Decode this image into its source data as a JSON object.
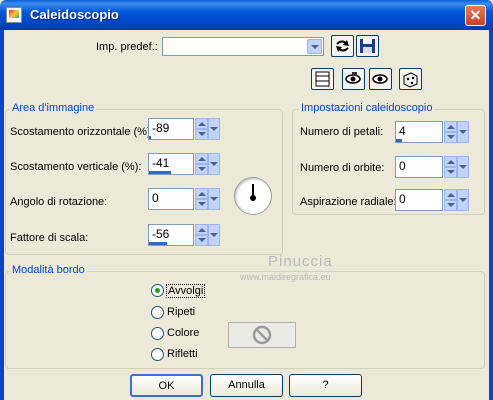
{
  "window": {
    "title": "Caleidoscopio",
    "close_glyph": "✕"
  },
  "preset": {
    "label": "Imp. predef.:",
    "value": ""
  },
  "toolbar": {
    "icons": [
      "reset-icon",
      "save-icon",
      "preview-window-icon",
      "eye-icon",
      "eye-icon",
      "randomize-icon"
    ]
  },
  "image_area": {
    "title": "Area d'immagine",
    "fields": [
      {
        "label": "Scostamento orizzontale (%):",
        "value": "-89"
      },
      {
        "label": "Scostamento verticale (%):",
        "value": "-41"
      },
      {
        "label": "Angolo di rotazione:",
        "value": "0"
      },
      {
        "label": "Fattore di scala:",
        "value": "-56"
      }
    ]
  },
  "kaleido": {
    "title": "Impostazioni caleidoscopio",
    "fields": [
      {
        "label": "Numero di petali:",
        "value": "4"
      },
      {
        "label": "Numero di orbite:",
        "value": "0"
      },
      {
        "label": "Aspirazione radiale:",
        "value": "0"
      }
    ]
  },
  "border_mode": {
    "title": "Modalità bordo",
    "options": [
      {
        "label": "Avvolgi",
        "selected": true
      },
      {
        "label": "Ripeti",
        "selected": false
      },
      {
        "label": "Colore",
        "selected": false
      },
      {
        "label": "Rifletti",
        "selected": false
      }
    ],
    "color_icon": "no-color-icon"
  },
  "watermark": {
    "name": "Pinuccia",
    "site": "www.maidiregrafica.eu"
  },
  "buttons": {
    "ok": "OK",
    "cancel": "Annulla",
    "help": "?"
  },
  "colors": {
    "titlebar": "#0054e3",
    "group_title": "#0046d5",
    "dialog_bg": "#ece9d8",
    "slider_fill": "#316ac5",
    "radio_dot": "#21a121"
  }
}
